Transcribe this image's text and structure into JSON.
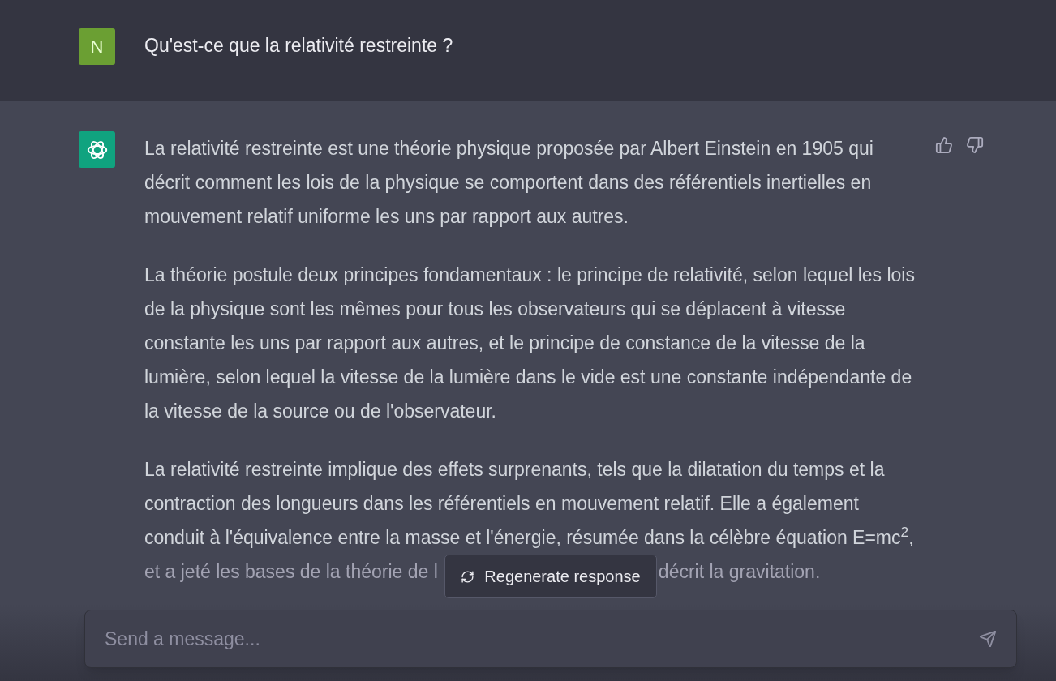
{
  "user_message": {
    "avatar_letter": "N",
    "text": "Qu'est-ce que la relativité restreinte ?"
  },
  "assistant_message": {
    "paragraphs": [
      "La relativité restreinte est une théorie physique proposée par Albert Einstein en 1905 qui décrit comment les lois de la physique se comportent dans des référentiels inertielles en mouvement relatif uniforme les uns par rapport aux autres.",
      "La théorie postule deux principes fondamentaux : le principe de relativité, selon lequel les lois de la physique sont les mêmes pour tous les observateurs qui se déplacent à vitesse constante les uns par rapport aux autres, et le principe de constance de la vitesse de la lumière, selon lequel la vitesse de la lumière dans le vide est une constante indépendante de la vitesse de la source ou de l'observateur.",
      "La relativité restreinte implique des effets surprenants, tels que la dilatation du temps et la contraction des longueurs dans les référentiels en mouvement relatif. Elle a également conduit à l'équivalence entre la masse et l'énergie, résumée dans la célèbre équation E=mc$^{2}$,"
    ],
    "covered_line": [
      "et a jeté les bases de la théorie de l",
      "décrit la gravitation."
    ]
  },
  "regenerate_button": {
    "label": "Regenerate response"
  },
  "composer": {
    "placeholder": "Send a message..."
  }
}
